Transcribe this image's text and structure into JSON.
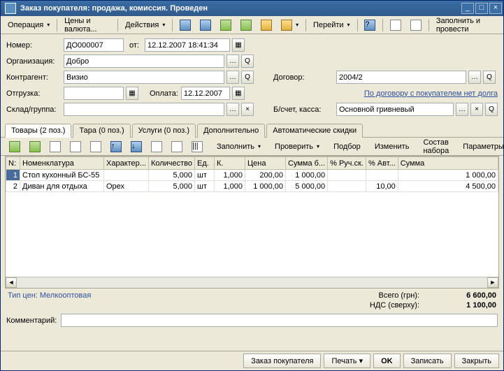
{
  "window": {
    "title": "Заказ покупателя: продажа, комиссия. Проведен"
  },
  "toolbar": {
    "operation": "Операция",
    "prices": "Цены и валюта...",
    "actions": "Действия",
    "goto": "Перейти",
    "fill_and_post": "Заполнить и провести"
  },
  "fields": {
    "number_lbl": "Номер:",
    "number": "ДО000007",
    "from_lbl": "от:",
    "date": "12.12.2007 18:41:34",
    "org_lbl": "Организация:",
    "org": "Добро",
    "contr_lbl": "Контрагент:",
    "contr": "Визио",
    "contract_lbl": "Договор:",
    "contract": "2004/2",
    "ship_lbl": "Отгрузка:",
    "ship": "",
    "pay_lbl": "Оплата:",
    "pay": "12.12.2007",
    "debt_note": "По договору с покупателем нет долга",
    "wh_lbl": "Склад/группа:",
    "wh": "",
    "acct_lbl": "Б/счет, касса:",
    "acct": "Основной гривневый"
  },
  "tabs": {
    "goods": "Товары (2 поз.)",
    "tare": "Тара (0 поз.)",
    "serv": "Услуги (0 поз.)",
    "extra": "Дополнительно",
    "disc": "Автоматические скидки"
  },
  "tabtb": {
    "fill": "Заполнить",
    "check": "Проверить",
    "pick": "Подбор",
    "edit": "Изменить",
    "set": "Состав набора",
    "params": "Параметры"
  },
  "gridh": {
    "n": "N:",
    "nom": "Номенклатура",
    "char": "Характер...",
    "qty": "Количество",
    "unit": "Ед.",
    "k": "К.",
    "price": "Цена",
    "sumb": "Сумма б...",
    "man": "% Руч.ск.",
    "auto": "% Авт...",
    "sum": "Сумма"
  },
  "rows": [
    {
      "n": "1",
      "nom": "Стол кухонный БС-55",
      "char": "",
      "qty": "5,000",
      "unit": "шт",
      "k": "1,000",
      "price": "200,00",
      "sumb": "1 000,00",
      "man": "",
      "auto": "",
      "sum": "1 000,00"
    },
    {
      "n": "2",
      "nom": "Диван для отдыха",
      "char": "Орех",
      "qty": "5,000",
      "unit": "шт",
      "k": "1,000",
      "price": "1 000,00",
      "sumb": "5 000,00",
      "man": "",
      "auto": "10,00",
      "sum": "4 500,00"
    }
  ],
  "totals": {
    "pricetype": "Тип цен: Мелкооптовая",
    "total_lbl": "Всего (грн):",
    "total": "6 600,00",
    "vat_lbl": "НДС (сверху):",
    "vat": "1 100,00"
  },
  "comment_lbl": "Комментарий:",
  "comment": "",
  "footer": {
    "order": "Заказ покупателя",
    "print": "Печать",
    "ok": "OK",
    "save": "Записать",
    "close": "Закрыть"
  }
}
